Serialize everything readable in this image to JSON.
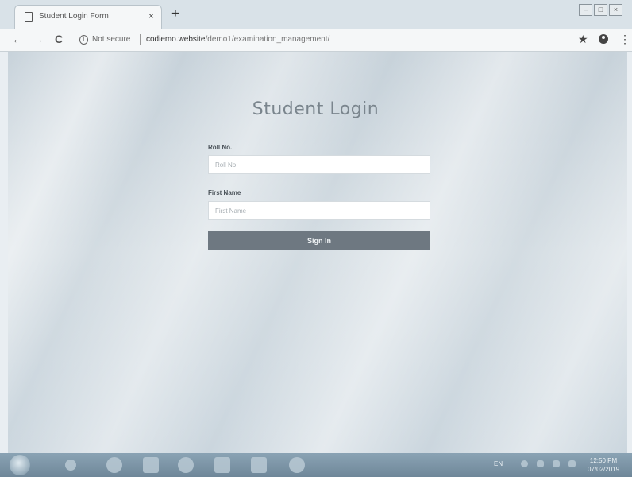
{
  "browser": {
    "tab": {
      "title": "Student Login Form",
      "close_glyph": "×",
      "icon": "document-icon"
    },
    "new_tab_glyph": "+",
    "window_buttons": [
      "–",
      "□",
      "×"
    ],
    "nav": {
      "back": "←",
      "forward": "→",
      "reload": "C"
    },
    "address": {
      "security_label": "Not secure",
      "url_domain": "codiemo.website",
      "url_path": "/demo1/examination_management/",
      "star_glyph": "★",
      "menu_glyph": "⋮"
    }
  },
  "page": {
    "title": "Student Login",
    "roll_label": "Roll No.",
    "roll_placeholder": "Roll No.",
    "roll_value": "",
    "first_name_label": "First Name",
    "first_name_placeholder": "First Name",
    "first_name_value": "",
    "signin_label": "Sign In"
  },
  "taskbar": {
    "tray": {
      "language": "EN"
    },
    "clock": {
      "time": "12:50 PM",
      "date": "07/02/2019"
    }
  },
  "colors": {
    "button_bg": "#6e7881",
    "title_text": "#7a858d",
    "taskbar": "#7b93a5"
  }
}
